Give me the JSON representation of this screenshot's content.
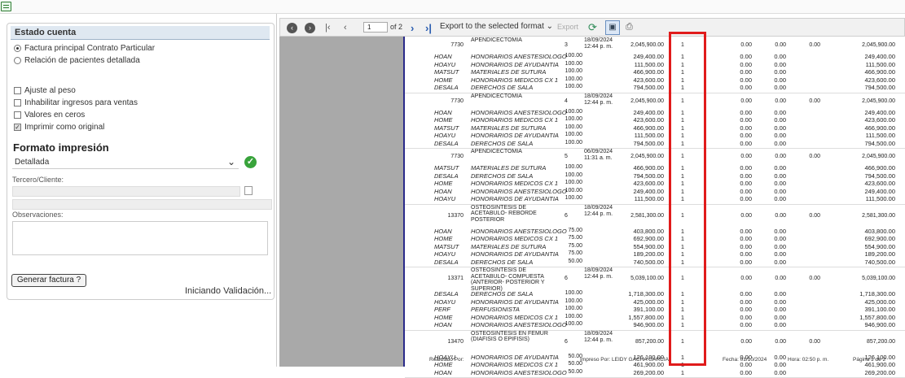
{
  "left": {
    "section_title": "Estado cuenta",
    "radios": [
      {
        "label": "Factura principal Contrato Particular",
        "checked": true
      },
      {
        "label": "Relación de pacientes detallada",
        "checked": false
      }
    ],
    "checks": [
      {
        "label": "Ajuste al peso",
        "checked": false
      },
      {
        "label": "Inhabilitar ingresos para ventas",
        "checked": false
      },
      {
        "label": "Valores en ceros",
        "checked": false
      },
      {
        "label": "Imprimir como original",
        "checked": true
      }
    ],
    "format_title": "Formato impresión",
    "format_value": "Detallada",
    "tercero_label": "Tercero/Cliente:",
    "obs_label": "Observaciones:",
    "generate_button": "Generar factura ?",
    "status": "Iniciando Validación..."
  },
  "toolbar": {
    "page_value": "1",
    "page_of": "of 2",
    "export_label": "Export to the selected format",
    "export_button": "Export"
  },
  "report": {
    "groups": [
      {
        "header": [
          "7730",
          "APENDICECTOMIA",
          "3",
          "18/09/2024",
          "12:44 p. m.",
          "2,045,900.00",
          "1",
          "0.00",
          "0.00",
          "0.00",
          "2,045,900.00"
        ],
        "rows": [
          [
            "HOAN",
            "HONORARIOS ANESTESIOLOGO",
            "100.00",
            "249,400.00",
            "1",
            "0.00",
            "0.00",
            "249,400.00"
          ],
          [
            "HOAYU",
            "HONORARIOS DE AYUDANTIA",
            "100.00",
            "111,500.00",
            "1",
            "0.00",
            "0.00",
            "111,500.00"
          ],
          [
            "MATSUT",
            "MATERIALES DE SUTURA",
            "100.00",
            "466,900.00",
            "1",
            "0.00",
            "0.00",
            "466,900.00"
          ],
          [
            "HOME",
            "HONORARIOS MEDICOS CX 1",
            "100.00",
            "423,600.00",
            "1",
            "0.00",
            "0.00",
            "423,600.00"
          ],
          [
            "DESALA",
            "DERECHOS DE SALA",
            "100.00",
            "794,500.00",
            "1",
            "0.00",
            "0.00",
            "794,500.00"
          ]
        ]
      },
      {
        "header": [
          "7730",
          "APENDICECTOMIA",
          "4",
          "18/09/2024",
          "12:44 p. m.",
          "2,045,900.00",
          "1",
          "0.00",
          "0.00",
          "0.00",
          "2,045,900.00"
        ],
        "rows": [
          [
            "HOAN",
            "HONORARIOS ANESTESIOLOGO",
            "100.00",
            "249,400.00",
            "1",
            "0.00",
            "0.00",
            "249,400.00"
          ],
          [
            "HOME",
            "HONORARIOS MEDICOS CX 1",
            "100.00",
            "423,600.00",
            "1",
            "0.00",
            "0.00",
            "423,600.00"
          ],
          [
            "MATSUT",
            "MATERIALES DE SUTURA",
            "100.00",
            "466,900.00",
            "1",
            "0.00",
            "0.00",
            "466,900.00"
          ],
          [
            "HOAYU",
            "HONORARIOS DE AYUDANTIA",
            "100.00",
            "111,500.00",
            "1",
            "0.00",
            "0.00",
            "111,500.00"
          ],
          [
            "DESALA",
            "DERECHOS DE SALA",
            "100.00",
            "794,500.00",
            "1",
            "0.00",
            "0.00",
            "794,500.00"
          ]
        ]
      },
      {
        "header": [
          "7730",
          "APENDICECTOMIA",
          "5",
          "06/09/2024",
          "11:31 a. m.",
          "2,045,900.00",
          "1",
          "0.00",
          "0.00",
          "0.00",
          "2,045,900.00"
        ],
        "rows": [
          [
            "MATSUT",
            "MATERIALES DE SUTURA",
            "100.00",
            "466,900.00",
            "1",
            "0.00",
            "0.00",
            "466,900.00"
          ],
          [
            "DESALA",
            "DERECHOS DE SALA",
            "100.00",
            "794,500.00",
            "1",
            "0.00",
            "0.00",
            "794,500.00"
          ],
          [
            "HOME",
            "HONORARIOS MEDICOS CX 1",
            "100.00",
            "423,600.00",
            "1",
            "0.00",
            "0.00",
            "423,600.00"
          ],
          [
            "HOAN",
            "HONORARIOS ANESTESIOLOGO",
            "100.00",
            "249,400.00",
            "1",
            "0.00",
            "0.00",
            "249,400.00"
          ],
          [
            "HOAYU",
            "HONORARIOS DE AYUDANTIA",
            "100.00",
            "111,500.00",
            "1",
            "0.00",
            "0.00",
            "111,500.00"
          ]
        ]
      },
      {
        "header": [
          "13370",
          "OSTEOSINTESIS DE ACETABULO- REBORDE POSTERIOR",
          "6",
          "18/09/2024",
          "12:44 p. m.",
          "2,581,300.00",
          "1",
          "0.00",
          "0.00",
          "0.00",
          "2,581,300.00"
        ],
        "rows": [
          [
            "HOAN",
            "HONORARIOS ANESTESIOLOGO",
            "75.00",
            "403,800.00",
            "1",
            "0.00",
            "0.00",
            "403,800.00"
          ],
          [
            "HOME",
            "HONORARIOS MEDICOS CX 1",
            "75.00",
            "692,900.00",
            "1",
            "0.00",
            "0.00",
            "692,900.00"
          ],
          [
            "MATSUT",
            "MATERIALES DE SUTURA",
            "75.00",
            "554,900.00",
            "1",
            "0.00",
            "0.00",
            "554,900.00"
          ],
          [
            "HOAYU",
            "HONORARIOS DE AYUDANTIA",
            "75.00",
            "189,200.00",
            "1",
            "0.00",
            "0.00",
            "189,200.00"
          ],
          [
            "DESALA",
            "DERECHOS DE SALA",
            "50.00",
            "740,500.00",
            "1",
            "0.00",
            "0.00",
            "740,500.00"
          ]
        ]
      },
      {
        "header": [
          "13371",
          "OSTEOSINTESIS DE ACETABULO- COMPUESTA (ANTERIOR- POSTERIOR Y SUPERIOR)",
          "6",
          "18/09/2024",
          "12:44 p. m.",
          "5,039,100.00",
          "1",
          "0.00",
          "0.00",
          "0.00",
          "5,039,100.00"
        ],
        "rows": [
          [
            "DESALA",
            "DERECHOS DE SALA",
            "100.00",
            "1,718,300.00",
            "1",
            "0.00",
            "0.00",
            "1,718,300.00"
          ],
          [
            "HOAYU",
            "HONORARIOS DE AYUDANTIA",
            "100.00",
            "425,000.00",
            "1",
            "0.00",
            "0.00",
            "425,000.00"
          ],
          [
            "PERF",
            "PERFUSIONISTA",
            "100.00",
            "391,100.00",
            "1",
            "0.00",
            "0.00",
            "391,100.00"
          ],
          [
            "HOME",
            "HONORARIOS MEDICOS CX 1",
            "100.00",
            "1,557,800.00",
            "1",
            "0.00",
            "0.00",
            "1,557,800.00"
          ],
          [
            "HOAN",
            "HONORARIOS ANESTESIOLOGO",
            "100.00",
            "946,900.00",
            "1",
            "0.00",
            "0.00",
            "946,900.00"
          ]
        ]
      },
      {
        "header": [
          "13470",
          "OSTEOSINTESIS EN FEMUR (DIAFISIS O EPIFISIS)",
          "6",
          "18/09/2024",
          "12:44 p. m.",
          "857,200.00",
          "1",
          "0.00",
          "0.00",
          "0.00",
          "857,200.00"
        ],
        "rows": [
          [
            "HOAYU",
            "HONORARIOS DE AYUDANTIA",
            "50.00",
            "126,100.00",
            "1",
            "0.00",
            "0.00",
            "126,100.00"
          ],
          [
            "HOME",
            "HONORARIOS MEDICOS CX 1",
            "50.00",
            "461,900.00",
            "1",
            "0.00",
            "0.00",
            "461,900.00"
          ],
          [
            "HOAN",
            "HONORARIOS ANESTESIOLOGO",
            "50.00",
            "269,200.00",
            "1",
            "0.00",
            "0.00",
            "269,200.00"
          ]
        ]
      }
    ],
    "footer": {
      "realizado": "Realizado Por:",
      "impreso": "Impreso Por:   LEIDY GACHA GARCIA",
      "fecha": "Fecha:  01/10/2024",
      "hora": "Hora:  02:50 p. m.",
      "pagina": "Página 1 de 2"
    }
  }
}
